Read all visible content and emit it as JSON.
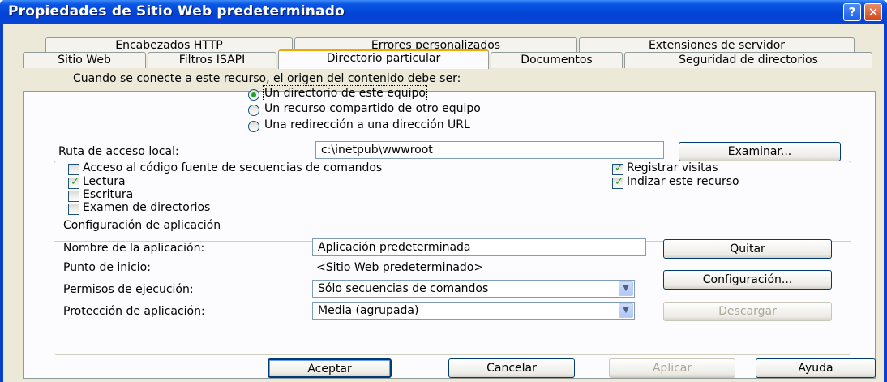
{
  "window": {
    "title": "Propiedades de Sitio Web predeterminado",
    "help_glyph": "?",
    "close_glyph": "✕"
  },
  "tabs_row1": [
    "Encabezados HTTP",
    "Errores personalizados",
    "Extensiones de servidor"
  ],
  "tabs_row2": [
    "Sitio Web",
    "Filtros ISAPI",
    "Directorio particular",
    "Documentos",
    "Seguridad de directorios"
  ],
  "active_tab": "Directorio particular",
  "content_source": {
    "prompt": "Cuando se conecte a este recurso, el origen del contenido debe ser:",
    "options": [
      "Un directorio de este equipo",
      "Un recurso compartido de otro equipo",
      "Una redirección a una dirección URL"
    ],
    "selected_index": 0
  },
  "local_path": {
    "label": "Ruta de acceso local:",
    "value": "c:\\inetpub\\wwwroot",
    "browse_button": "Examinar..."
  },
  "permissions": [
    {
      "label": "Acceso al código fuente de secuencias de comandos",
      "checked": false
    },
    {
      "label": "Lectura",
      "checked": true
    },
    {
      "label": "Escritura",
      "checked": false
    },
    {
      "label": "Examen de directorios",
      "checked": false
    },
    {
      "label": "Registrar visitas",
      "checked": true
    },
    {
      "label": "Indizar este recurso",
      "checked": true
    }
  ],
  "app_settings": {
    "section_label": "Configuración de aplicación",
    "name_label": "Nombre de la aplicación:",
    "name_value": "Aplicación predeterminada",
    "remove_button": "Quitar",
    "start_point_label": "Punto de inicio:",
    "start_point_value": "<Sitio Web predeterminado>",
    "config_button": "Configuración...",
    "exec_perm_label": "Permisos de ejecución:",
    "exec_perm_value": "Sólo secuencias de comandos",
    "protection_label": "Protección de aplicación:",
    "protection_value": "Media (agrupada)",
    "unload_button": "Descargar"
  },
  "footer": {
    "ok": "Aceptar",
    "cancel": "Cancelar",
    "apply": "Aplicar",
    "help": "Ayuda"
  }
}
